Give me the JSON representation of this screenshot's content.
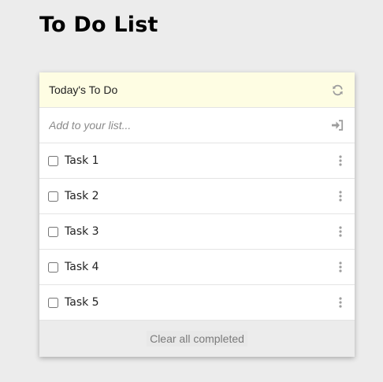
{
  "page": {
    "title": "To Do List"
  },
  "list": {
    "header_title": "Today's To Do",
    "refresh_icon": "refresh-icon",
    "add_placeholder": "Add to your list...",
    "add_icon": "sign-in-icon",
    "tasks": [
      {
        "label": "Task 1",
        "checked": false
      },
      {
        "label": "Task 2",
        "checked": false
      },
      {
        "label": "Task 3",
        "checked": false
      },
      {
        "label": "Task 4",
        "checked": false
      },
      {
        "label": "Task 5",
        "checked": false
      }
    ],
    "more_icon": "vertical-ellipsis-icon",
    "clear_label": "Clear all completed"
  },
  "colors": {
    "page_bg": "#ececec",
    "header_bg": "#fefde3",
    "icon_gray": "#9e9e9e"
  }
}
